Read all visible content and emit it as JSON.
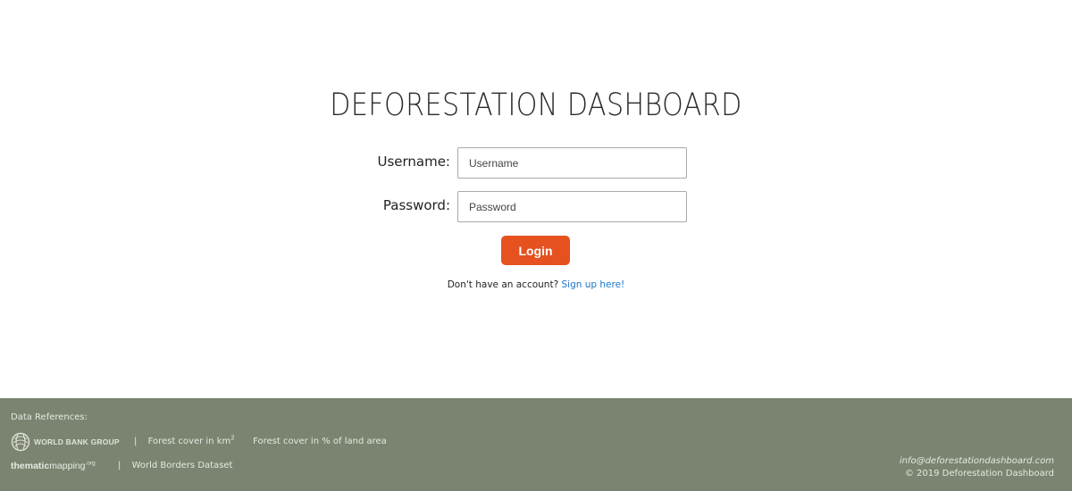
{
  "login": {
    "title": "DEFORESTATION DASHBOARD",
    "username_label": "Username:",
    "username_placeholder": "Username",
    "password_label": "Password:",
    "password_placeholder": "Password",
    "login_button": "Login",
    "signup_prompt": "Don't have an account?",
    "signup_link": "Sign up here!"
  },
  "footer": {
    "refs_title": "Data References:",
    "world_bank_logo_text": "WORLD BANK GROUP",
    "separator": "|",
    "forest_cover_km_prefix": "Forest cover in km",
    "forest_cover_km_sup": "2",
    "forest_cover_percent": "Forest cover in % of land area",
    "thematic_bold": "thematic",
    "thematic_rest": "mapping",
    "thematic_org": ".org",
    "world_borders": "World Borders Dataset",
    "email": "info@deforestationdashboard.com",
    "copyright": "© 2019 Deforestation Dashboard"
  },
  "colors": {
    "login_button": "#e5511f",
    "link": "#1a75c9",
    "footer_bg": "#7b8470"
  }
}
